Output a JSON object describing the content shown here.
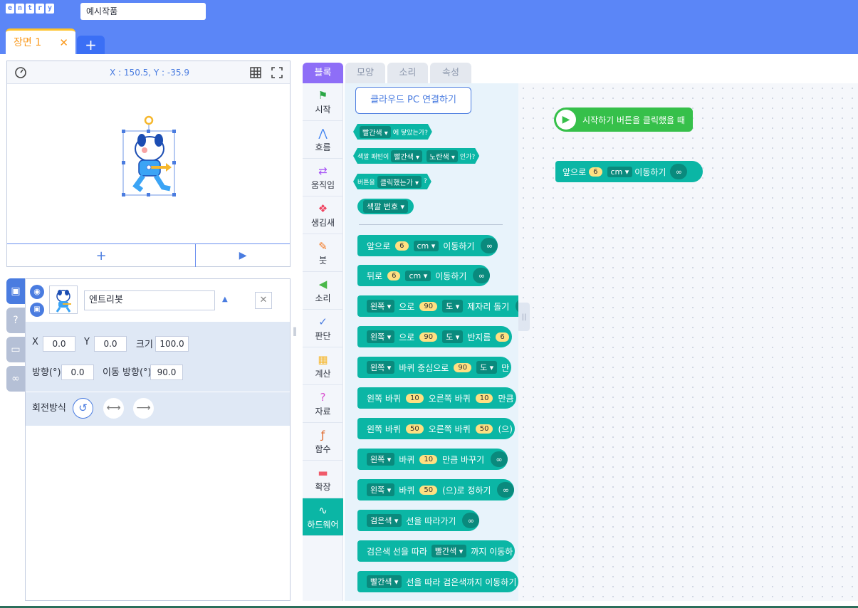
{
  "header": {
    "logo_letters": [
      "e",
      "n",
      "t",
      "r",
      "y"
    ],
    "project_title": "예시작품",
    "scene_tab": "장면 1",
    "scene_close": "✕",
    "add_scene": "+"
  },
  "stage": {
    "coords": "X : 150.5, Y : -35.9",
    "add_object": "+",
    "play": "▶"
  },
  "object": {
    "name": "엔트리봇",
    "x_label": "X",
    "x_value": "0.0",
    "y_label": "Y",
    "y_value": "0.0",
    "size_label": "크기",
    "size_value": "100.0",
    "dir_label": "방향(°)",
    "dir_value": "0.0",
    "move_dir_label": "이동 방향(°)",
    "move_dir_value": "90.0",
    "rotation_label": "회전방식"
  },
  "tabs": [
    "블록",
    "모양",
    "소리",
    "속성"
  ],
  "categories": [
    {
      "label": "시작",
      "icon": "⚑",
      "color": "#2aa745"
    },
    {
      "label": "흐름",
      "icon": "⋀",
      "color": "#3f82f0"
    },
    {
      "label": "움직임",
      "icon": "⇄",
      "color": "#a551f5"
    },
    {
      "label": "생김새",
      "icon": "❖",
      "color": "#f0415e"
    },
    {
      "label": "붓",
      "icon": "✎",
      "color": "#f47a25"
    },
    {
      "label": "소리",
      "icon": "◀",
      "color": "#4ab84a"
    },
    {
      "label": "판단",
      "icon": "✓",
      "color": "#4a7ce0"
    },
    {
      "label": "계산",
      "icon": "▦",
      "color": "#f6b72c"
    },
    {
      "label": "자료",
      "icon": "?",
      "color": "#d84fcf"
    },
    {
      "label": "함수",
      "icon": "ƒ",
      "color": "#e0682a"
    },
    {
      "label": "확장",
      "icon": "▬",
      "color": "#f05a6a"
    },
    {
      "label": "하드웨어",
      "icon": "∿",
      "color": "#ffffff"
    }
  ],
  "palette": {
    "cloud_button": "클라우드 PC 연결하기",
    "hex1": {
      "dd": "빨간색 ▾",
      "text": "에 닿았는가?"
    },
    "hex2": {
      "pre": "색깔 패턴이",
      "dd1": "빨간색 ▾",
      "dd2": "노란색 ▾",
      "post": "인가?"
    },
    "hex3": {
      "pre": "버튼을",
      "dd": "클릭했는가 ▾",
      "post": "?"
    },
    "round1": {
      "dd": "색깔 번호 ▾"
    },
    "blocks": [
      {
        "parts": [
          {
            "t": "text",
            "v": "앞으로"
          },
          {
            "t": "num",
            "v": "6"
          },
          {
            "t": "dd",
            "v": "cm ▾"
          },
          {
            "t": "text",
            "v": "이동하기"
          }
        ]
      },
      {
        "parts": [
          {
            "t": "text",
            "v": "뒤로"
          },
          {
            "t": "num",
            "v": "6"
          },
          {
            "t": "dd",
            "v": "cm ▾"
          },
          {
            "t": "text",
            "v": "이동하기"
          }
        ]
      },
      {
        "parts": [
          {
            "t": "dd",
            "v": "왼쪽 ▾"
          },
          {
            "t": "text",
            "v": "으로"
          },
          {
            "t": "num",
            "v": "90"
          },
          {
            "t": "dd",
            "v": "도 ▾"
          },
          {
            "t": "text",
            "v": "제자리 돌기"
          }
        ]
      },
      {
        "parts": [
          {
            "t": "dd",
            "v": "왼쪽 ▾"
          },
          {
            "t": "text",
            "v": "으로"
          },
          {
            "t": "num",
            "v": "90"
          },
          {
            "t": "dd",
            "v": "도 ▾"
          },
          {
            "t": "text",
            "v": "반지름"
          },
          {
            "t": "num",
            "v": "6"
          }
        ]
      },
      {
        "parts": [
          {
            "t": "dd",
            "v": "왼쪽 ▾"
          },
          {
            "t": "text",
            "v": "바퀴 중심으로"
          },
          {
            "t": "num",
            "v": "90"
          },
          {
            "t": "dd",
            "v": "도 ▾"
          },
          {
            "t": "text",
            "v": "만"
          }
        ]
      },
      {
        "parts": [
          {
            "t": "text",
            "v": "왼쪽 바퀴"
          },
          {
            "t": "num",
            "v": "10"
          },
          {
            "t": "text",
            "v": "오른쪽 바퀴"
          },
          {
            "t": "num",
            "v": "10"
          },
          {
            "t": "text",
            "v": "만큼"
          }
        ]
      },
      {
        "parts": [
          {
            "t": "text",
            "v": "왼쪽 바퀴"
          },
          {
            "t": "num",
            "v": "50"
          },
          {
            "t": "text",
            "v": "오른쪽 바퀴"
          },
          {
            "t": "num",
            "v": "50"
          },
          {
            "t": "text",
            "v": "(으)"
          }
        ]
      },
      {
        "parts": [
          {
            "t": "dd",
            "v": "왼쪽 ▾"
          },
          {
            "t": "text",
            "v": "바퀴"
          },
          {
            "t": "num",
            "v": "10"
          },
          {
            "t": "text",
            "v": "만큼 바꾸기"
          }
        ]
      },
      {
        "parts": [
          {
            "t": "dd",
            "v": "왼쪽 ▾"
          },
          {
            "t": "text",
            "v": "바퀴"
          },
          {
            "t": "num",
            "v": "50"
          },
          {
            "t": "text",
            "v": "(으)로 정하기"
          }
        ]
      },
      {
        "parts": [
          {
            "t": "dd",
            "v": "검은색 ▾"
          },
          {
            "t": "text",
            "v": "선을 따라가기"
          }
        ]
      },
      {
        "parts": [
          {
            "t": "text",
            "v": "검은색 선을 따라"
          },
          {
            "t": "dd",
            "v": "빨간색 ▾"
          },
          {
            "t": "text",
            "v": "까지 이동하"
          }
        ]
      },
      {
        "parts": [
          {
            "t": "dd",
            "v": "빨간색 ▾"
          },
          {
            "t": "text",
            "v": "선을 따라 검은색까지 이동하기"
          }
        ]
      }
    ]
  },
  "workspace": {
    "start_block": "시작하기 버튼을 클릭했을 때",
    "move_block": {
      "pre": "앞으로",
      "num": "6",
      "dd": "cm ▾",
      "post": "이동하기"
    }
  }
}
